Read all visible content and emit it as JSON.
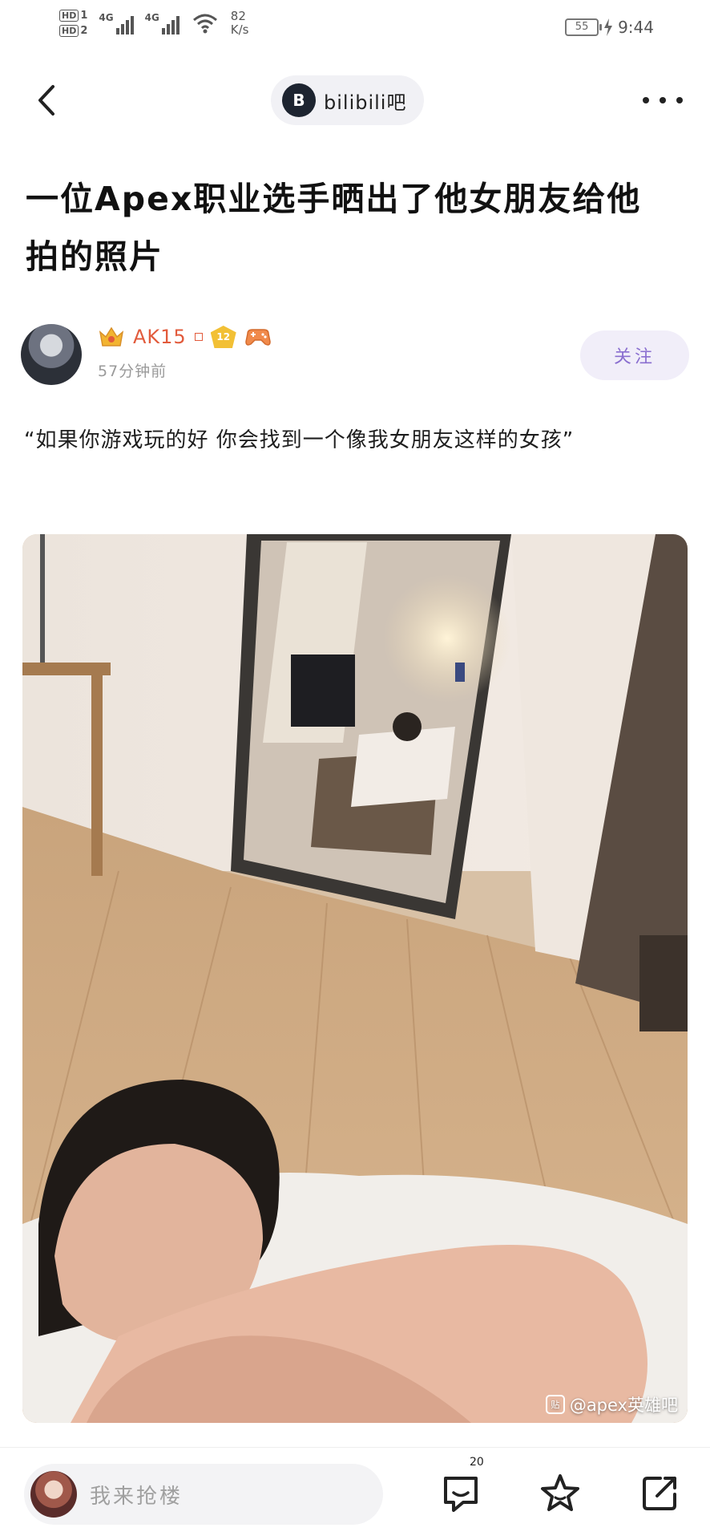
{
  "status_bar": {
    "hd1": "HD",
    "hd1_sub": "1",
    "hd2": "HD",
    "hd2_sub": "2",
    "net1": "4G",
    "net2": "4G",
    "speed_value": "82",
    "speed_unit": "K/s",
    "battery": "55",
    "time": "9:44"
  },
  "nav": {
    "forum_name": "bilibili吧",
    "forum_avatar_glyph": "B"
  },
  "post": {
    "title": "一位Apex职业选手晒出了他女朋友给他拍的照片",
    "author_name": "AK15",
    "level": "12",
    "time_ago": "57分钟前",
    "follow_label": "关注",
    "body": "“如果你游戏玩的好 你会找到一个像我女朋友这样的女孩”",
    "watermark": "@apex英雄吧",
    "watermark_icon": "贴"
  },
  "bottom_bar": {
    "reply_placeholder": "我来抢楼",
    "comment_count": "20"
  },
  "colors": {
    "author_name": "#e25b3c",
    "follow_text": "#8a6fd0",
    "follow_bg": "#f1eef9",
    "level_badge": "#f2c035"
  }
}
